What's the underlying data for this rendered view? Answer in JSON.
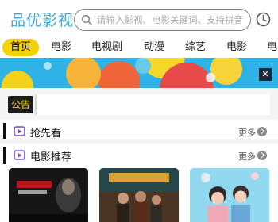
{
  "header": {
    "logo_text": "品优影视",
    "search_placeholder": "请输入影视、电影关键词、支持拼音",
    "icons": {
      "search": "search-icon",
      "history": "history-icon"
    }
  },
  "nav": {
    "tabs": [
      {
        "label": "首页",
        "active": true
      },
      {
        "label": "电影",
        "active": false
      },
      {
        "label": "电视剧",
        "active": false
      },
      {
        "label": "动漫",
        "active": false
      },
      {
        "label": "综艺",
        "active": false
      },
      {
        "label": "电影",
        "active": false
      },
      {
        "label": "电",
        "active": false
      }
    ]
  },
  "banner": {
    "close_label": "✕"
  },
  "notice": {
    "badge_label": "公告",
    "text": ""
  },
  "sections": [
    {
      "title": "抢先看",
      "more_label": "更多",
      "icon": "play-icon"
    },
    {
      "title": "电影推荐",
      "more_label": "更多",
      "icon": "play-icon"
    }
  ],
  "colors": {
    "brand": "#3aa7d6",
    "accent": "#f6d100",
    "banner_bg": "#2fb3e6"
  }
}
